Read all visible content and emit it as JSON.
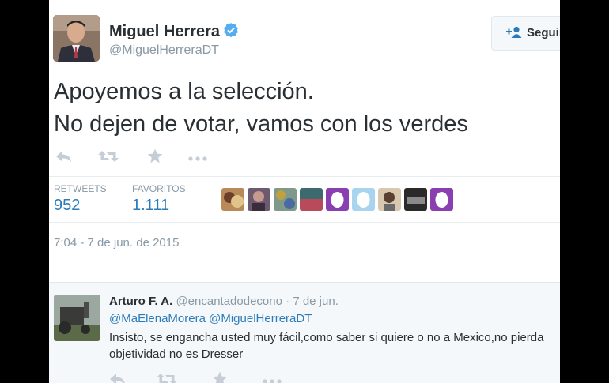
{
  "header": {
    "display_name": "Miguel Herrera",
    "handle": "@MiguelHerreraDT",
    "follow_label": "Seguir"
  },
  "tweet": {
    "text_line1": "Apoyemos a la selección.",
    "text_line2": "No dejen de votar, vamos con los verdes"
  },
  "stats": {
    "retweets_label": "RETWEETS",
    "retweets_value": "952",
    "favorites_label": "FAVORITOS",
    "favorites_value": "1.111"
  },
  "timestamp": "7:04 - 7 de jun. de 2015",
  "reply": {
    "name": "Arturo F. A.",
    "handle": "@encantadodecono",
    "separator": " · ",
    "date": "7 de jun.",
    "mentions": "@MaElenaMorera @MiguelHerreraDT",
    "text": "Insisto, se engancha usted muy fácil,como saber si quiere o no a Mexico,no pierda objetividad no es Dresser"
  },
  "colors": {
    "link_blue": "#2b7bb9",
    "verified_blue": "#55acee",
    "muted_gray": "#8899a6",
    "icon_gray": "#c5ced6"
  },
  "icons": [
    "verified-badge-icon",
    "add-user-icon",
    "reply-icon",
    "retweet-icon",
    "favorite-star-icon",
    "more-icon"
  ]
}
